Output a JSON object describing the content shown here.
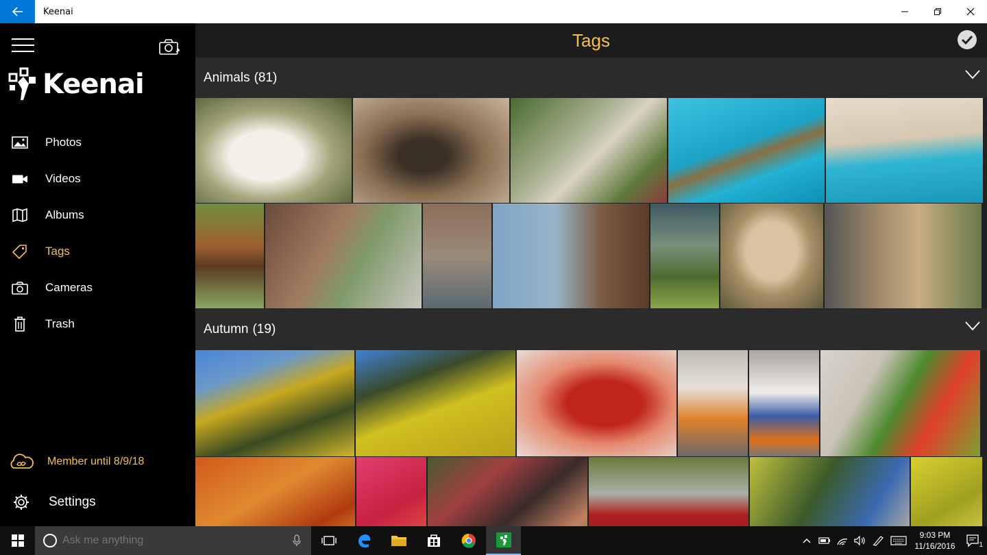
{
  "window": {
    "title": "Keenai"
  },
  "sidebar": {
    "brand": "Keenai",
    "items": [
      {
        "label": "Photos",
        "icon": "photo-icon"
      },
      {
        "label": "Videos",
        "icon": "video-camera-icon"
      },
      {
        "label": "Albums",
        "icon": "album-icon"
      },
      {
        "label": "Tags",
        "icon": "tag-icon",
        "active": true
      },
      {
        "label": "Cameras",
        "icon": "camera-icon"
      },
      {
        "label": "Trash",
        "icon": "trash-icon"
      }
    ],
    "member": "Member until 8/9/18",
    "settings": "Settings"
  },
  "main": {
    "title": "Tags",
    "sections": [
      {
        "title": "Animals",
        "count": "(81)"
      },
      {
        "title": "Autumn",
        "count": "(19)"
      }
    ]
  },
  "taskbar": {
    "search_placeholder": "Ask me anything",
    "time": "9:03 PM",
    "date": "11/16/2016",
    "notification_count": "1"
  },
  "colors": {
    "accent": "#f4c14d",
    "titlebar_back": "#0078d7"
  }
}
